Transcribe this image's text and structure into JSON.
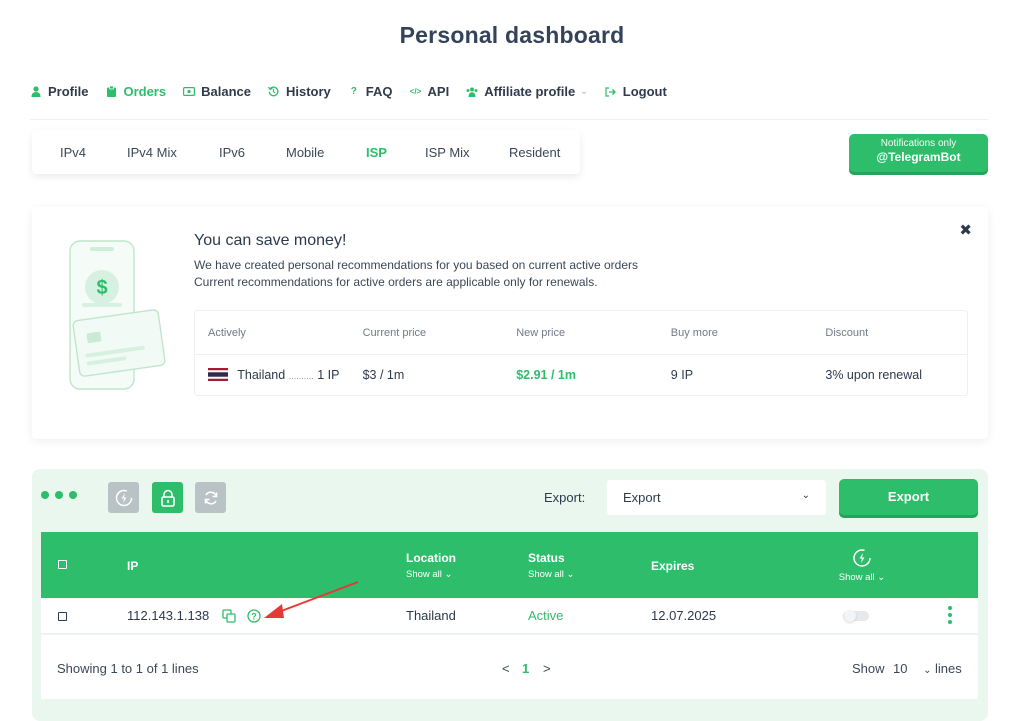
{
  "page": {
    "title": "Personal dashboard"
  },
  "nav": {
    "items": [
      {
        "label": "Profile",
        "icon": "user-icon",
        "active": false
      },
      {
        "label": "Orders",
        "icon": "clipboard-icon",
        "active": true
      },
      {
        "label": "Balance",
        "icon": "wallet-icon",
        "active": false
      },
      {
        "label": "History",
        "icon": "history-icon",
        "active": false
      },
      {
        "label": "FAQ",
        "icon": "question-icon",
        "active": false
      },
      {
        "label": "API",
        "icon": "code-icon",
        "active": false
      },
      {
        "label": "Affiliate profile",
        "icon": "users-icon",
        "active": false
      },
      {
        "label": "Logout",
        "icon": "logout-icon",
        "active": false
      }
    ]
  },
  "proxy_tabs": [
    {
      "label": "IPv4",
      "active": false
    },
    {
      "label": "IPv4 Mix",
      "active": false
    },
    {
      "label": "IPv6",
      "active": false
    },
    {
      "label": "Mobile",
      "active": false
    },
    {
      "label": "ISP",
      "active": true
    },
    {
      "label": "ISP Mix",
      "active": false
    },
    {
      "label": "Resident",
      "active": false
    }
  ],
  "telegram_button": {
    "small": "Notifications only",
    "big": "@TelegramBot"
  },
  "save_card": {
    "title": "You can save money!",
    "line1": "We have created personal recommendations for you based on current active orders",
    "line2": "Current recommendations for active orders are applicable only for renewals.",
    "close_icon": "close-icon",
    "table": {
      "headers": [
        "Actively",
        "Current price",
        "New price",
        "Buy more",
        "Discount"
      ],
      "row": {
        "country": "Thailand",
        "dots": "..........",
        "count": "1 IP",
        "current_price": "$3 / 1m",
        "new_price": "$2.91 / 1m",
        "buy_more": "9 IP",
        "discount": "3% upon renewal"
      }
    }
  },
  "orders": {
    "export_label": "Export:",
    "export_select": "Export",
    "export_button": "Export",
    "columns": {
      "ip": "IP",
      "location": "Location",
      "location_filter": "Show all",
      "status": "Status",
      "status_filter": "Show all",
      "expires": "Expires",
      "autorenew_filter": "Show all"
    },
    "rows": [
      {
        "ip": "112.143.1.138",
        "location": "Thailand",
        "status": "Active",
        "expires": "12.07.2025"
      }
    ],
    "footer": {
      "showing": "Showing 1 to 1 of 1 lines",
      "prev": "<",
      "page": "1",
      "next": ">",
      "show_label": "Show",
      "per_page": "10",
      "lines_label": "lines"
    }
  },
  "colors": {
    "accent": "#2ebd6b",
    "panel_bg": "#e9f7ee",
    "arrow": "#e53935"
  }
}
